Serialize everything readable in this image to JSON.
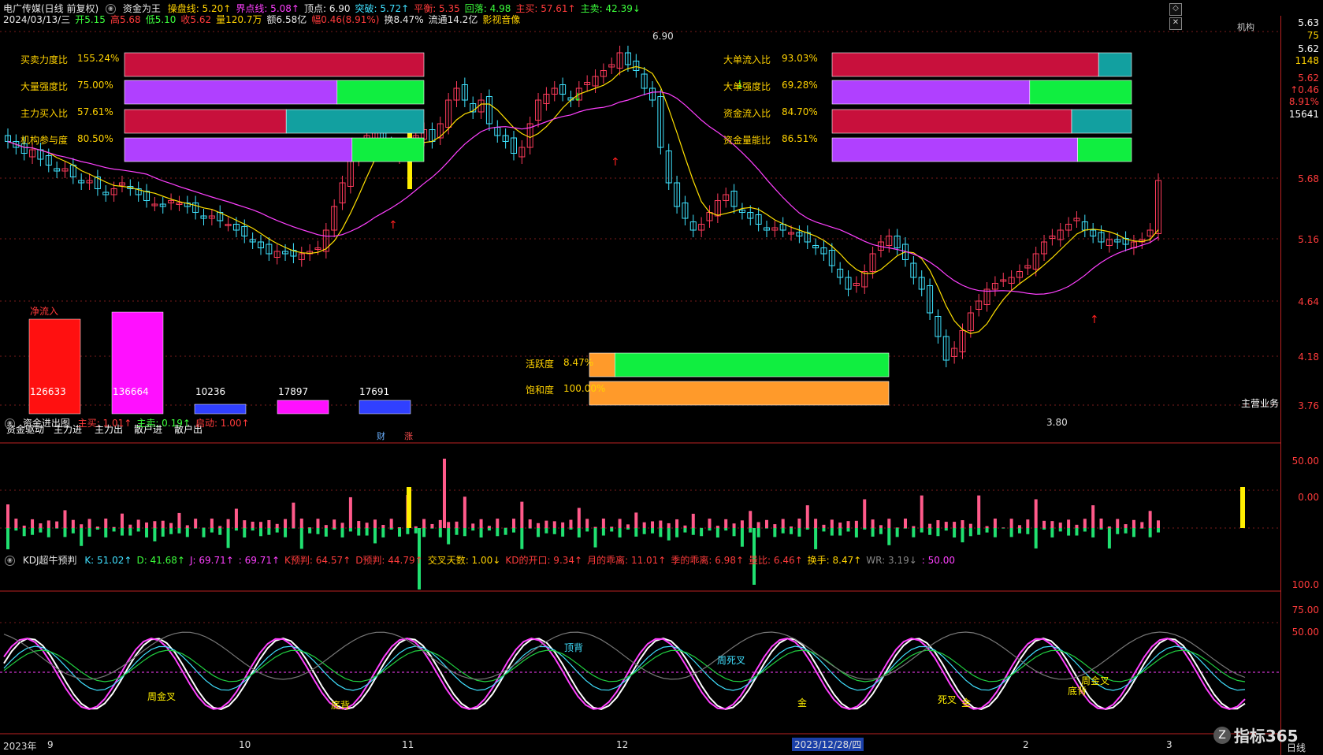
{
  "header": {
    "stock_title": "电广传媒(日线 前复权)",
    "formula_name": "资金为王",
    "items": [
      {
        "label": "操盘线: 5.20↑",
        "color": "#ffd200"
      },
      {
        "label": "界点线: 5.08↑",
        "color": "#ff40ff"
      },
      {
        "label": "顶点: 6.90",
        "color": "#e8e8e8"
      },
      {
        "label": "突破: 5.72↑",
        "color": "#40e0ff"
      },
      {
        "label": "平衡: 5.35",
        "color": "#ff3b3b"
      },
      {
        "label": "回落: 4.98",
        "color": "#3cff3c"
      },
      {
        "label": "主买: 57.61↑",
        "color": "#ff3b3b"
      },
      {
        "label": "主卖: 42.39↓",
        "color": "#3cff3c"
      }
    ],
    "info_row": [
      {
        "label": "2024/03/13/三",
        "color": "#e8e8e8"
      },
      {
        "label": "开5.15",
        "color": "#3cff3c"
      },
      {
        "label": "高5.68",
        "color": "#ff3b3b"
      },
      {
        "label": "低5.10",
        "color": "#3cff3c"
      },
      {
        "label": "收5.62",
        "color": "#ff3b3b"
      },
      {
        "label": "量120.7万",
        "color": "#ffd200"
      },
      {
        "label": "额6.58亿",
        "color": "#e8e8e8"
      },
      {
        "label": "幅0.46(8.91%)",
        "color": "#ff3b3b"
      },
      {
        "label": "换8.47%",
        "color": "#e8e8e8"
      },
      {
        "label": "流通14.2亿",
        "color": "#e8e8e8"
      },
      {
        "label": "影视音像",
        "color": "#ffd200"
      }
    ],
    "corner_tag": "机构"
  },
  "right_axis": {
    "labels": [
      {
        "text": "5.63",
        "color": "#ffffff"
      },
      {
        "text": "75",
        "color": "#ffd200"
      },
      {
        "text": "5.62",
        "color": "#ffffff"
      },
      {
        "text": "1148",
        "color": "#ffd200"
      },
      {
        "text": "5.62",
        "color": "#ff3b3b"
      },
      {
        "text": "↑0.46",
        "color": "#ff3b3b"
      },
      {
        "text": "8.91%",
        "color": "#ff3b3b"
      },
      {
        "text": "15641",
        "color": "#ffffff"
      },
      {
        "text": "5.68",
        "color": "#ff3b3b"
      },
      {
        "text": "5.16",
        "color": "#ff3b3b"
      },
      {
        "text": "4.64",
        "color": "#ff3b3b"
      },
      {
        "text": "4.18",
        "color": "#ff3b3b"
      },
      {
        "text": "3.76",
        "color": "#ff3b3b"
      },
      {
        "text": "50.00",
        "color": "#ff3b3b"
      },
      {
        "text": "0.00",
        "color": "#ff3b3b"
      },
      {
        "text": "100.0",
        "color": "#ff3b3b"
      },
      {
        "text": "75.00",
        "color": "#ff3b3b"
      },
      {
        "text": "50.00",
        "color": "#ff3b3b"
      }
    ]
  },
  "main_chart": {
    "high_mark": "6.90",
    "low_mark": "3.80",
    "sector_label": "主营业务",
    "badges": [
      "财",
      "涨"
    ]
  },
  "left_bars": [
    {
      "label": "买卖力度比",
      "value": "155.24%"
    },
    {
      "label": "大量强度比",
      "value": "75.00%"
    },
    {
      "label": "主力买入比",
      "value": "57.61%"
    },
    {
      "label": "机构参与度",
      "value": "80.50%"
    }
  ],
  "right_bars": [
    {
      "label": "大单流入比",
      "value": "93.03%"
    },
    {
      "label": "大单强度比",
      "value": "69.28%"
    },
    {
      "label": "资金流入比",
      "value": "84.70%"
    },
    {
      "label": "资金量能比",
      "value": "86.51%"
    }
  ],
  "activity": [
    {
      "label": "活跃度",
      "value": "8.47%"
    },
    {
      "label": "饱和度",
      "value": "100.00%"
    }
  ],
  "fund_flow": {
    "net_inflow_label": "净流入",
    "values": [
      "126633",
      "136664",
      "10236",
      "17897",
      "17691"
    ],
    "axis_labels": [
      "资金驱动",
      "主力进",
      "主力出",
      "散户进",
      "散户出"
    ]
  },
  "panel2": {
    "title": "资金进出图",
    "items": [
      {
        "label": "主买: 1.01↑",
        "color": "#ff3b3b"
      },
      {
        "label": "主卖: 0.19↑",
        "color": "#3cff3c"
      },
      {
        "label": "启动: 1.00↑",
        "color": "#ff3b3b"
      }
    ]
  },
  "panel3": {
    "title": "KDJ超牛预判",
    "items": [
      {
        "label": "K: 51.02↑",
        "color": "#40e0ff"
      },
      {
        "label": "D: 41.68↑",
        "color": "#3cff3c"
      },
      {
        "label": "J: 69.71↑",
        "color": "#ff40ff"
      },
      {
        "label": ": 69.71↑",
        "color": "#ff40ff"
      },
      {
        "label": "K预判: 64.57↑",
        "color": "#ff3b3b"
      },
      {
        "label": "D预判: 44.79↑",
        "color": "#ff3b3b"
      },
      {
        "label": "交叉天数: 1.00↓",
        "color": "#ffd200"
      },
      {
        "label": "KD的开口: 9.34↑",
        "color": "#ff3b3b"
      },
      {
        "label": "月的乖离: 11.01↑",
        "color": "#ff3b3b"
      },
      {
        "label": "季的乖离: 6.98↑",
        "color": "#ff3b3b"
      },
      {
        "label": "量比: 6.46↑",
        "color": "#ff3b3b"
      },
      {
        "label": "换手: 8.47↑",
        "color": "#ffd200"
      },
      {
        "label": "WR: 3.19↓",
        "color": "#888888"
      },
      {
        "label": ": 50.00",
        "color": "#ff40ff"
      }
    ],
    "annotations": [
      "顶背",
      "周死叉",
      "周金叉",
      "底背",
      "周金叉",
      "金",
      "金",
      "死叉",
      "底背"
    ]
  },
  "x_axis": {
    "labels": [
      "2023年",
      "9",
      "10",
      "11",
      "12",
      "2023/12/28/四",
      "2",
      "3",
      "日线"
    ]
  },
  "logo_text": "指标365"
}
